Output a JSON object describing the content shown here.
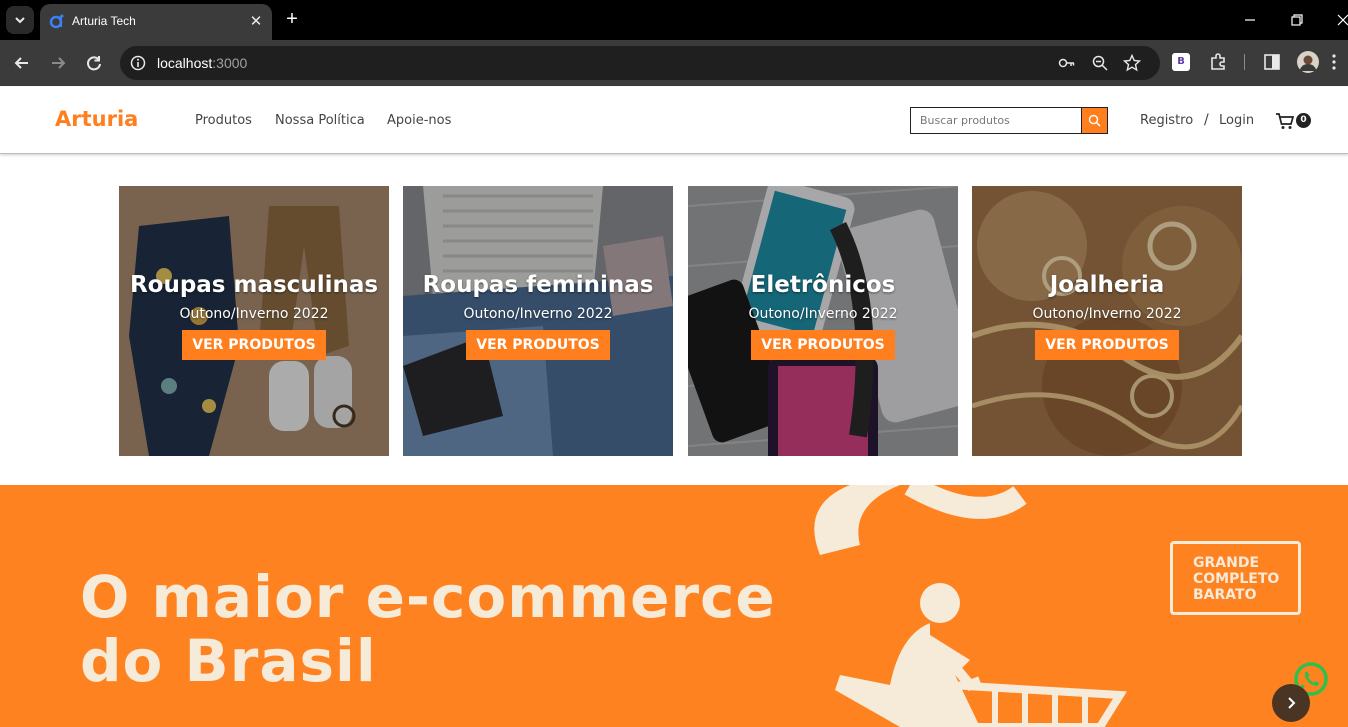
{
  "browser": {
    "tab_title": "Arturia Tech",
    "url_host": "localhost",
    "url_port": ":3000",
    "extension_label": "B"
  },
  "header": {
    "brand": "Arturia",
    "nav": [
      "Produtos",
      "Nossa Política",
      "Apoie-nos"
    ],
    "search_placeholder": "Buscar produtos",
    "register": "Registro",
    "separator": "/",
    "login": "Login",
    "cart_count": "0"
  },
  "categories": [
    {
      "title": "Roupas masculinas",
      "subtitle": "Outono/Inverno 2022",
      "button": "VER PRODUTOS"
    },
    {
      "title": "Roupas femininas",
      "subtitle": "Outono/Inverno 2022",
      "button": "VER PRODUTOS"
    },
    {
      "title": "Eletrônicos",
      "subtitle": "Outono/Inverno 2022",
      "button": "VER PRODUTOS"
    },
    {
      "title": "Joalheria",
      "subtitle": "Outono/Inverno 2022",
      "button": "VER PRODUTOS"
    }
  ],
  "banner": {
    "headline_line1": "O maior e-commerce",
    "headline_line2": "do Brasil",
    "stamp": [
      "GRANDE",
      "COMPLETO",
      "BARATO"
    ]
  },
  "colors": {
    "accent": "#ff7f1e",
    "banner_bg": "#ff8220",
    "banner_text": "#f6ead9"
  },
  "icons": {
    "whatsapp": "whatsapp-icon",
    "carousel_next": "chevron-right-icon",
    "cart": "cart-icon",
    "search": "search-icon"
  }
}
